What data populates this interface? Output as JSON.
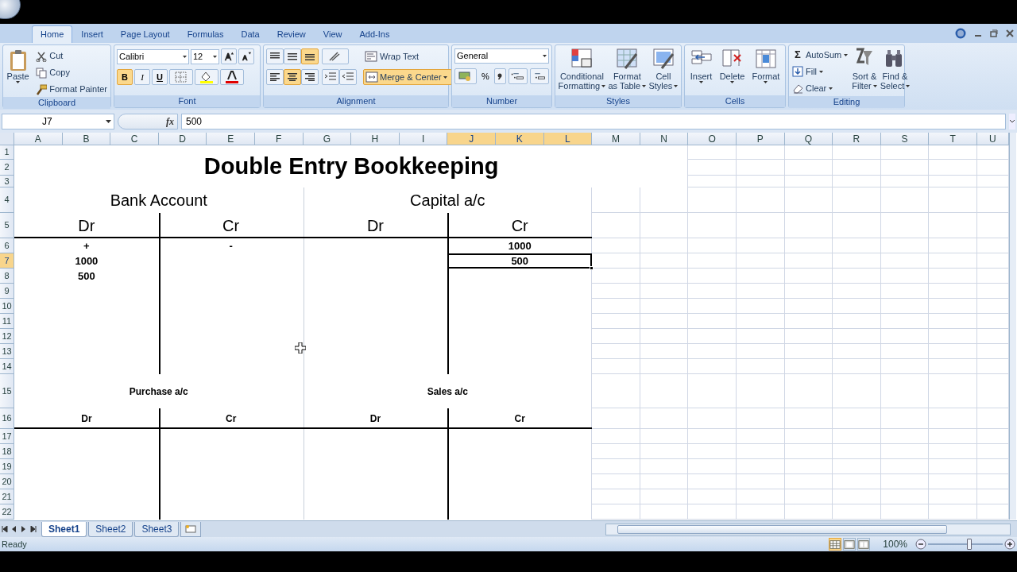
{
  "ribbon_tabs": [
    {
      "label": "Home",
      "selected": true
    },
    {
      "label": "Insert",
      "selected": false
    },
    {
      "label": "Page Layout",
      "selected": false
    },
    {
      "label": "Formulas",
      "selected": false
    },
    {
      "label": "Data",
      "selected": false
    },
    {
      "label": "Review",
      "selected": false
    },
    {
      "label": "View",
      "selected": false
    },
    {
      "label": "Add-Ins",
      "selected": false
    }
  ],
  "clipboard": {
    "title": "Clipboard",
    "paste": "Paste",
    "items": [
      "Cut",
      "Copy",
      "Format Painter"
    ]
  },
  "font": {
    "title": "Font",
    "name": "Calibri",
    "size": "12",
    "styles": [
      {
        "label": "B",
        "kind": "bold",
        "on": true
      },
      {
        "label": "I",
        "kind": "italic",
        "on": false
      },
      {
        "label": "U",
        "kind": "underline",
        "on": false
      }
    ]
  },
  "alignment": {
    "title": "Alignment",
    "vertical": [
      {
        "kind": "top",
        "on": false
      },
      {
        "kind": "middle",
        "on": false
      },
      {
        "kind": "bottom",
        "on": true
      }
    ],
    "horizontal": [
      {
        "kind": "left",
        "on": false
      },
      {
        "kind": "center",
        "on": true
      },
      {
        "kind": "right",
        "on": false
      }
    ],
    "wrap_text": "Wrap Text",
    "merge": {
      "label": "Merge & Center",
      "on": true
    }
  },
  "number": {
    "title": "Number",
    "format": "General",
    "percent": "%"
  },
  "styles": {
    "title": "Styles",
    "buttons": [
      [
        "Conditional",
        "Formatting"
      ],
      [
        "Format",
        "as Table"
      ],
      [
        "Cell",
        "Styles"
      ]
    ]
  },
  "cells": {
    "title": "Cells",
    "buttons": [
      "Insert",
      "Delete",
      "Format"
    ]
  },
  "editing": {
    "title": "Editing",
    "sigma": "Σ",
    "small": [
      "AutoSum",
      "Fill",
      "Clear"
    ],
    "big": [
      [
        "Sort &",
        "Filter"
      ],
      [
        "Find &",
        "Select"
      ]
    ]
  },
  "formula_bar": {
    "name_box": "J7",
    "fx": "fx",
    "value": "500"
  },
  "columns": [
    {
      "label": "A",
      "selected": false
    },
    {
      "label": "B",
      "selected": false
    },
    {
      "label": "C",
      "selected": false
    },
    {
      "label": "D",
      "selected": false
    },
    {
      "label": "E",
      "selected": false
    },
    {
      "label": "F",
      "selected": false
    },
    {
      "label": "G",
      "selected": false
    },
    {
      "label": "H",
      "selected": false
    },
    {
      "label": "I",
      "selected": false
    },
    {
      "label": "J",
      "selected": true
    },
    {
      "label": "K",
      "selected": true
    },
    {
      "label": "L",
      "selected": true
    },
    {
      "label": "M",
      "selected": false
    },
    {
      "label": "N",
      "selected": false
    },
    {
      "label": "O",
      "selected": false
    },
    {
      "label": "P",
      "selected": false
    },
    {
      "label": "Q",
      "selected": false
    },
    {
      "label": "R",
      "selected": false
    },
    {
      "label": "S",
      "selected": false
    },
    {
      "label": "T",
      "selected": false
    },
    {
      "label": "U",
      "selected": false
    }
  ],
  "rows": [
    {
      "label": "1",
      "selected": false
    },
    {
      "label": "2",
      "selected": false
    },
    {
      "label": "3",
      "selected": false
    },
    {
      "label": "4",
      "selected": false
    },
    {
      "label": "5",
      "selected": false
    },
    {
      "label": "6",
      "selected": false
    },
    {
      "label": "7",
      "selected": true
    },
    {
      "label": "8",
      "selected": false
    },
    {
      "label": "9",
      "selected": false
    },
    {
      "label": "10",
      "selected": false
    },
    {
      "label": "11",
      "selected": false
    },
    {
      "label": "12",
      "selected": false
    },
    {
      "label": "13",
      "selected": false
    },
    {
      "label": "14",
      "selected": false
    },
    {
      "label": "15",
      "selected": false
    },
    {
      "label": "16",
      "selected": false
    },
    {
      "label": "17",
      "selected": false
    },
    {
      "label": "18",
      "selected": false
    },
    {
      "label": "19",
      "selected": false
    },
    {
      "label": "20",
      "selected": false
    },
    {
      "label": "21",
      "selected": false
    },
    {
      "label": "22",
      "selected": false
    }
  ],
  "sheet_title": "Double Entry Bookkeeping",
  "accounts": [
    {
      "title": "Bank Account",
      "dr": "Dr",
      "cr": "Cr",
      "dr_entries": [
        {
          "text": "+",
          "selected": false
        },
        {
          "text": "1000",
          "selected": false
        },
        {
          "text": "500",
          "selected": false
        }
      ],
      "cr_entries": [
        {
          "text": "-",
          "selected": false
        }
      ]
    },
    {
      "title": "Capital a/c",
      "dr": "Dr",
      "cr": "Cr",
      "cr_entries": [
        {
          "text": "1000",
          "selected": false
        },
        {
          "text": "500",
          "selected": true
        }
      ]
    },
    {
      "title": "Purchase a/c",
      "dr": "Dr",
      "cr": "Cr"
    },
    {
      "title": "Sales a/c",
      "dr": "Dr",
      "cr": "Cr"
    }
  ],
  "sheet_tabs": [
    {
      "label": "Sheet1",
      "selected": true
    },
    {
      "label": "Sheet2",
      "selected": false
    },
    {
      "label": "Sheet3",
      "selected": false
    }
  ],
  "status_bar": {
    "status": "Ready",
    "views": [
      {
        "kind": "normal",
        "selected": true
      },
      {
        "kind": "layout",
        "selected": false
      },
      {
        "kind": "break",
        "selected": false
      }
    ],
    "zoom": "100%",
    "zoom_slider": {
      "level": 0.55
    }
  }
}
